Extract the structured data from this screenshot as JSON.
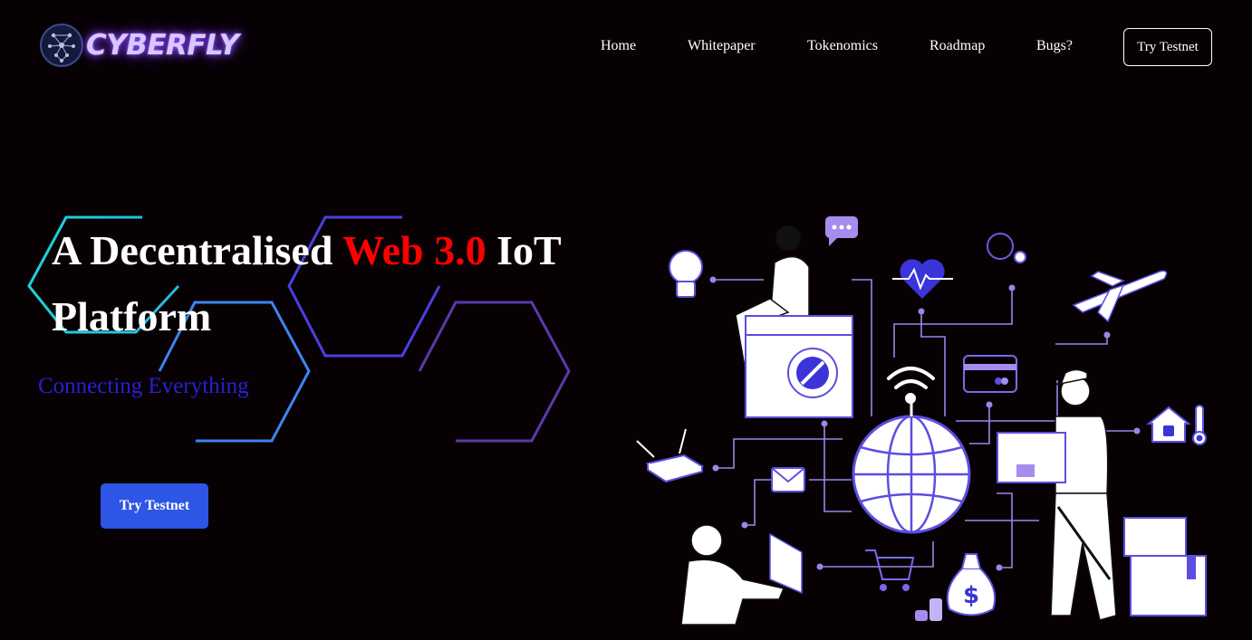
{
  "brand": {
    "name": "CYBERFLY",
    "logo_icon": "network-node-icon"
  },
  "nav": {
    "items": [
      "Home",
      "Whitepaper",
      "Tokenomics",
      "Roadmap",
      "Bugs?"
    ],
    "cta_label": "Try Testnet"
  },
  "hero": {
    "title_part1": "A Decentralised ",
    "title_accent": "Web 3.0",
    "title_part2": " IoT Platform",
    "subtitle": "Connecting Everything",
    "cta_label": "Try Testnet"
  },
  "colors": {
    "background": "#070104",
    "accent_red": "#ff0000",
    "subtitle_blue": "#2a1fd6",
    "button_blue": "#2d55e6",
    "illustration_purple": "#5b4ee0"
  },
  "illustration_icons": [
    "bulb-icon",
    "chat-bubble-icon",
    "heart-rate-icon",
    "weather-icon",
    "airplane-icon",
    "washing-machine-icon",
    "wifi-icon",
    "credit-card-icon",
    "globe-icon",
    "router-icon",
    "mail-icon",
    "shopping-cart-icon",
    "money-bag-icon",
    "smart-home-icon",
    "thermometer-icon",
    "package-icon"
  ]
}
